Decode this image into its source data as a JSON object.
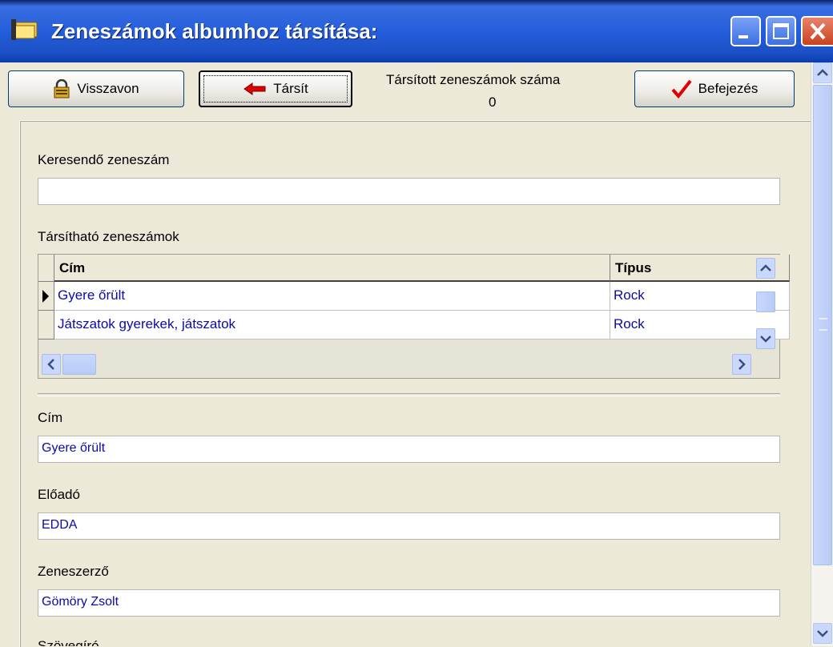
{
  "window": {
    "title": "Zeneszámok albumhoz társítása:"
  },
  "toolbar": {
    "undo_label": "Visszavon",
    "assign_label": "Társít",
    "finish_label": "Befejezés",
    "count_label": "Társított zeneszámok száma",
    "count_value": "0"
  },
  "search": {
    "label": "Keresendő zeneszám",
    "value": ""
  },
  "grid": {
    "label": "Társítható zeneszámok",
    "columns": [
      "Cím",
      "Típus"
    ],
    "rows": [
      {
        "title": "Gyere őrült",
        "type": "Rock"
      },
      {
        "title": "Játszatok gyerekek, játszatok",
        "type": "Rock"
      }
    ]
  },
  "details": {
    "title_label": "Cím",
    "title_value": "Gyere őrült",
    "performer_label": "Előadó",
    "performer_value": "EDDA",
    "composer_label": "Zeneszerző",
    "composer_value": "Gömöry Zsolt",
    "lyricist_label": "Szövegíró"
  },
  "colors": {
    "titlebar": "#245edb",
    "face": "#ece9d8",
    "value_text": "#0a0aa6"
  }
}
